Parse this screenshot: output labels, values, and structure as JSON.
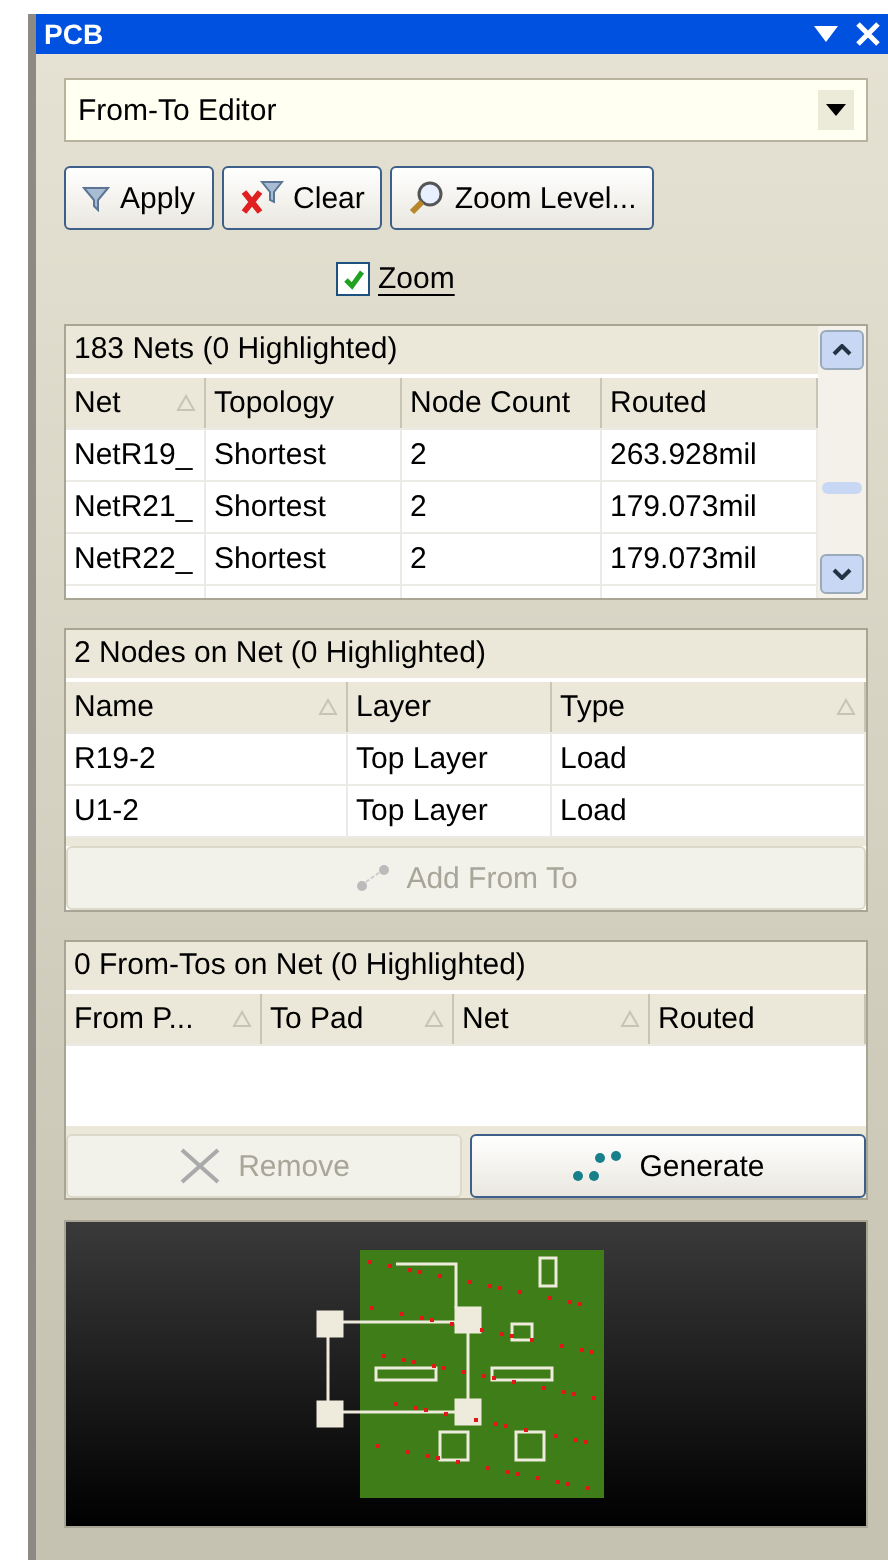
{
  "window": {
    "title": "PCB"
  },
  "mode_select": {
    "value": "From-To Editor"
  },
  "toolbar": [
    {
      "kind": "apply",
      "label": "Apply"
    },
    {
      "kind": "clear",
      "label": "Clear"
    },
    {
      "kind": "zoom",
      "label": "Zoom Level..."
    }
  ],
  "zoom_checkbox": {
    "label": "Zoom",
    "checked": true
  },
  "nets": {
    "title": "183 Nets (0 Highlighted)",
    "columns": [
      {
        "label": "Net",
        "sorted": true
      },
      {
        "label": "Topology",
        "sorted": false
      },
      {
        "label": "Node Count",
        "sorted": false
      },
      {
        "label": "Routed",
        "sorted": false
      }
    ],
    "rows": [
      [
        "NetR19_",
        "Shortest",
        "2",
        "263.928mil"
      ],
      [
        "NetR21_",
        "Shortest",
        "2",
        "179.073mil"
      ],
      [
        "NetR22_",
        "Shortest",
        "2",
        "179.073mil"
      ]
    ]
  },
  "nodes": {
    "title": "2 Nodes on Net (0 Highlighted)",
    "columns": [
      {
        "label": "Name",
        "sorted": true
      },
      {
        "label": "Layer",
        "sorted": false
      },
      {
        "label": "Type",
        "sorted": true
      }
    ],
    "rows": [
      [
        "R19-2",
        "Top Layer",
        "Load"
      ],
      [
        "U1-2",
        "Top Layer",
        "Load"
      ]
    ],
    "button": {
      "label": "Add From To",
      "disabled": true
    }
  },
  "from_tos": {
    "title": "0 From-Tos on Net (0 Highlighted)",
    "columns": [
      {
        "label": "From P...",
        "sorted": true
      },
      {
        "label": "To Pad",
        "sorted": true
      },
      {
        "label": "Net",
        "sorted": true
      },
      {
        "label": "Routed",
        "sorted": false
      }
    ],
    "buttons": [
      {
        "kind": "remove",
        "label": "Remove",
        "disabled": true
      },
      {
        "kind": "generate",
        "label": "Generate",
        "disabled": false
      }
    ]
  }
}
